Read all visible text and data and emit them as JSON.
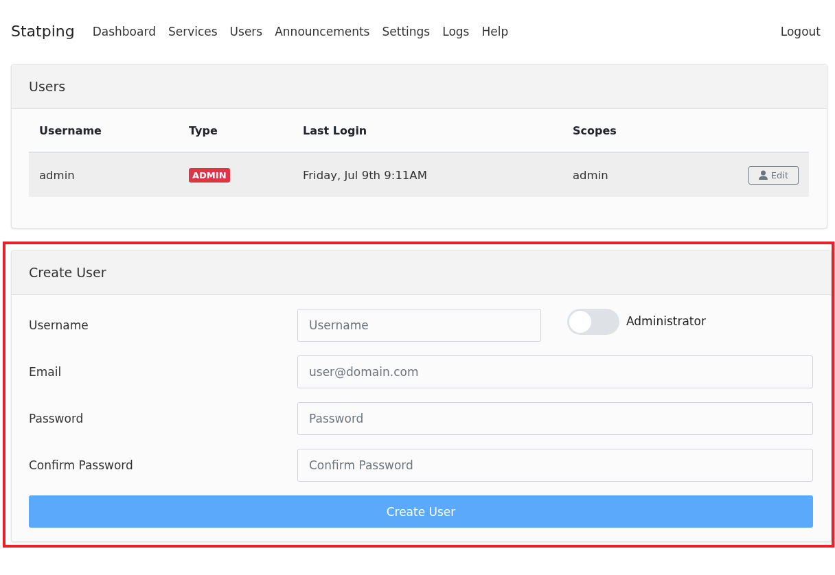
{
  "nav": {
    "brand": "Statping",
    "links": [
      "Dashboard",
      "Services",
      "Users",
      "Announcements",
      "Settings",
      "Logs",
      "Help"
    ],
    "logout": "Logout"
  },
  "users_card": {
    "title": "Users",
    "columns": [
      "Username",
      "Type",
      "Last Login",
      "Scopes"
    ],
    "rows": [
      {
        "username": "admin",
        "type": "ADMIN",
        "last_login": "Friday, Jul 9th 9:11AM",
        "scopes": "admin",
        "edit": "Edit"
      }
    ]
  },
  "create_card": {
    "title": "Create User",
    "highlighted": true,
    "fields": [
      {
        "label": "Username",
        "placeholder": "Username",
        "kind": "with_toggle",
        "toggle_label": "Administrator",
        "on": false
      },
      {
        "label": "Email",
        "placeholder": "user@domain.com",
        "kind": "text"
      },
      {
        "label": "Password",
        "placeholder": "Password",
        "kind": "text"
      },
      {
        "label": "Confirm Password",
        "placeholder": "Confirm Password",
        "kind": "text"
      }
    ],
    "submit": "Create User"
  }
}
